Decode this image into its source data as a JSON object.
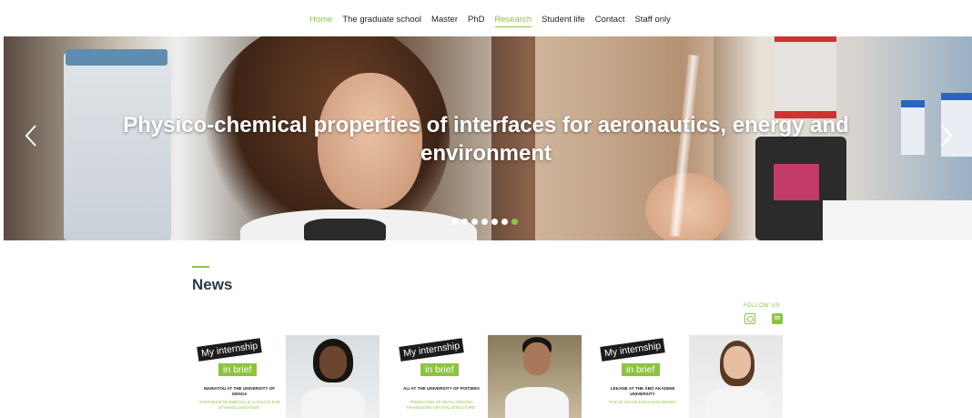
{
  "nav": {
    "items": [
      {
        "label": "Home",
        "state": "active"
      },
      {
        "label": "The graduate school",
        "state": ""
      },
      {
        "label": "Master",
        "state": ""
      },
      {
        "label": "PhD",
        "state": ""
      },
      {
        "label": "Research",
        "state": "current"
      },
      {
        "label": "Student life",
        "state": ""
      },
      {
        "label": "Contact",
        "state": ""
      },
      {
        "label": "Staff only",
        "state": ""
      }
    ]
  },
  "hero": {
    "title": "Physico-chemical properties of interfaces for aeronautics, energy and environment",
    "prev_icon": "chevron-left-icon",
    "next_icon": "chevron-right-icon",
    "slides_total": 7,
    "active_slide": 7
  },
  "news": {
    "title": "News",
    "follow_label": "FOLLOW US",
    "social": [
      {
        "name": "instagram-icon",
        "label": ""
      },
      {
        "name": "linkedin-icon",
        "label": "in"
      }
    ],
    "cards": [
      {
        "badge_top": "My internship",
        "badge_bottom": "in brief",
        "caption": "MARIATOU AT THE UNIVERSITY OF GENOA",
        "subcaption": "\"SYNTHESIS OF BIMETALLIC CATALYST FOR ETHANOL OXIDATION\""
      },
      {
        "badge_top": "My internship",
        "badge_bottom": "in brief",
        "caption": "ALI AT THE UNIVERSITY OF POITIERS",
        "subcaption": "\"PREDICTION OF METAL-ORGANIC FRAMEWORK CRYSTAL STRUCTURE\""
      },
      {
        "badge_top": "My internship",
        "badge_bottom": "in brief",
        "caption": "LEKANE AT THE ÅBO AKADEMI UNIVERSITY",
        "subcaption": "\"FOCUS ON ION EXCHANGE RESINS\""
      }
    ]
  },
  "colors": {
    "accent": "#8cc43f",
    "heading": "#2d3a43",
    "badge_dark": "#1c1c1c"
  }
}
